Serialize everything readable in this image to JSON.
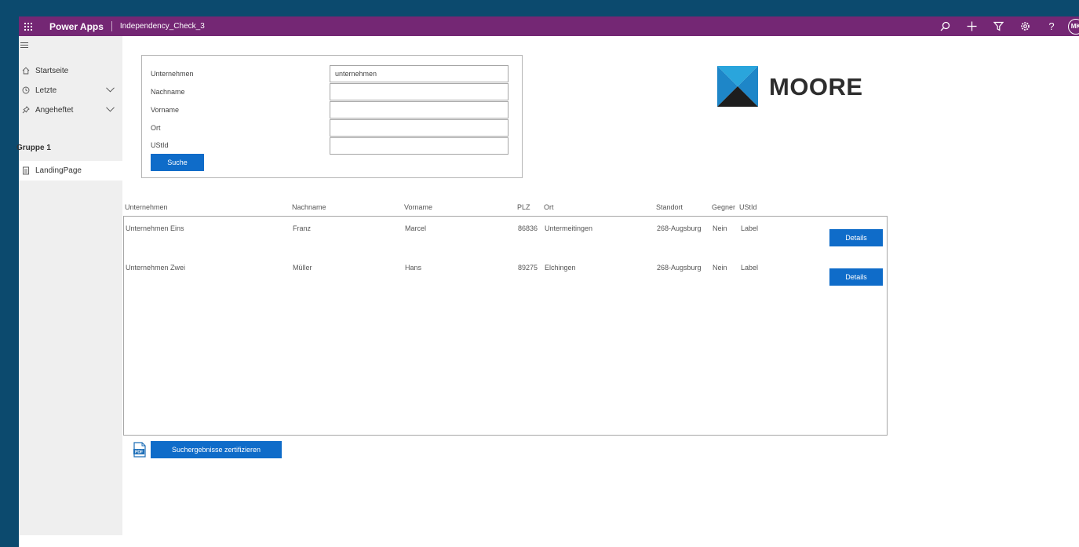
{
  "topbar": {
    "brand": "Power Apps",
    "app_name": "Independency_Check_3",
    "avatar_initials": "MK",
    "color": "#742774",
    "icons": [
      "search-icon",
      "plus-icon",
      "filter-icon",
      "settings-icon",
      "help-icon"
    ],
    "help_glyph": "?"
  },
  "sidebar": {
    "items": [
      {
        "label": "Startseite",
        "icon": "home-icon"
      },
      {
        "label": "Letzte",
        "icon": "clock-icon"
      },
      {
        "label": "Angeheftet",
        "icon": "pin-icon"
      }
    ],
    "group_label": "Gruppe 1",
    "group_items": [
      {
        "label": "LandingPage",
        "icon": "page-icon"
      }
    ]
  },
  "search_form": {
    "fields": [
      {
        "label": "Unternehmen",
        "value": "unternehmen"
      },
      {
        "label": "Nachname",
        "value": ""
      },
      {
        "label": "Vorname",
        "value": ""
      },
      {
        "label": "Ort",
        "value": ""
      },
      {
        "label": "UStId",
        "value": ""
      }
    ],
    "search_button": "Suche"
  },
  "logo": {
    "text": "MOORE"
  },
  "results": {
    "columns": [
      "Unternehmen",
      "Nachname",
      "Vorname",
      "PLZ",
      "Ort",
      "Standort",
      "Gegner",
      "UStId"
    ],
    "rows": [
      {
        "unternehmen": "Unternehmen Eins",
        "nachname": "Franz",
        "vorname": "Marcel",
        "plz": "86836",
        "ort": "Untermeitingen",
        "standort": "268-Augsburg",
        "gegner": "Nein",
        "ustid": "Label",
        "button": "Details"
      },
      {
        "unternehmen": "Unternehmen Zwei",
        "nachname": "Müller",
        "vorname": "Hans",
        "plz": "89275",
        "ort": "Elchingen",
        "standort": "268-Augsburg",
        "gegner": "Nein",
        "ustid": "Label",
        "button": "Details"
      }
    ]
  },
  "certify": {
    "button": "Suchergebnisse zertifizieren",
    "icon": "pdf-icon",
    "icon_text": "PDF"
  },
  "colors": {
    "accent": "#0f6cc9",
    "topbar": "#742774",
    "outer": "#0c4a6e"
  }
}
